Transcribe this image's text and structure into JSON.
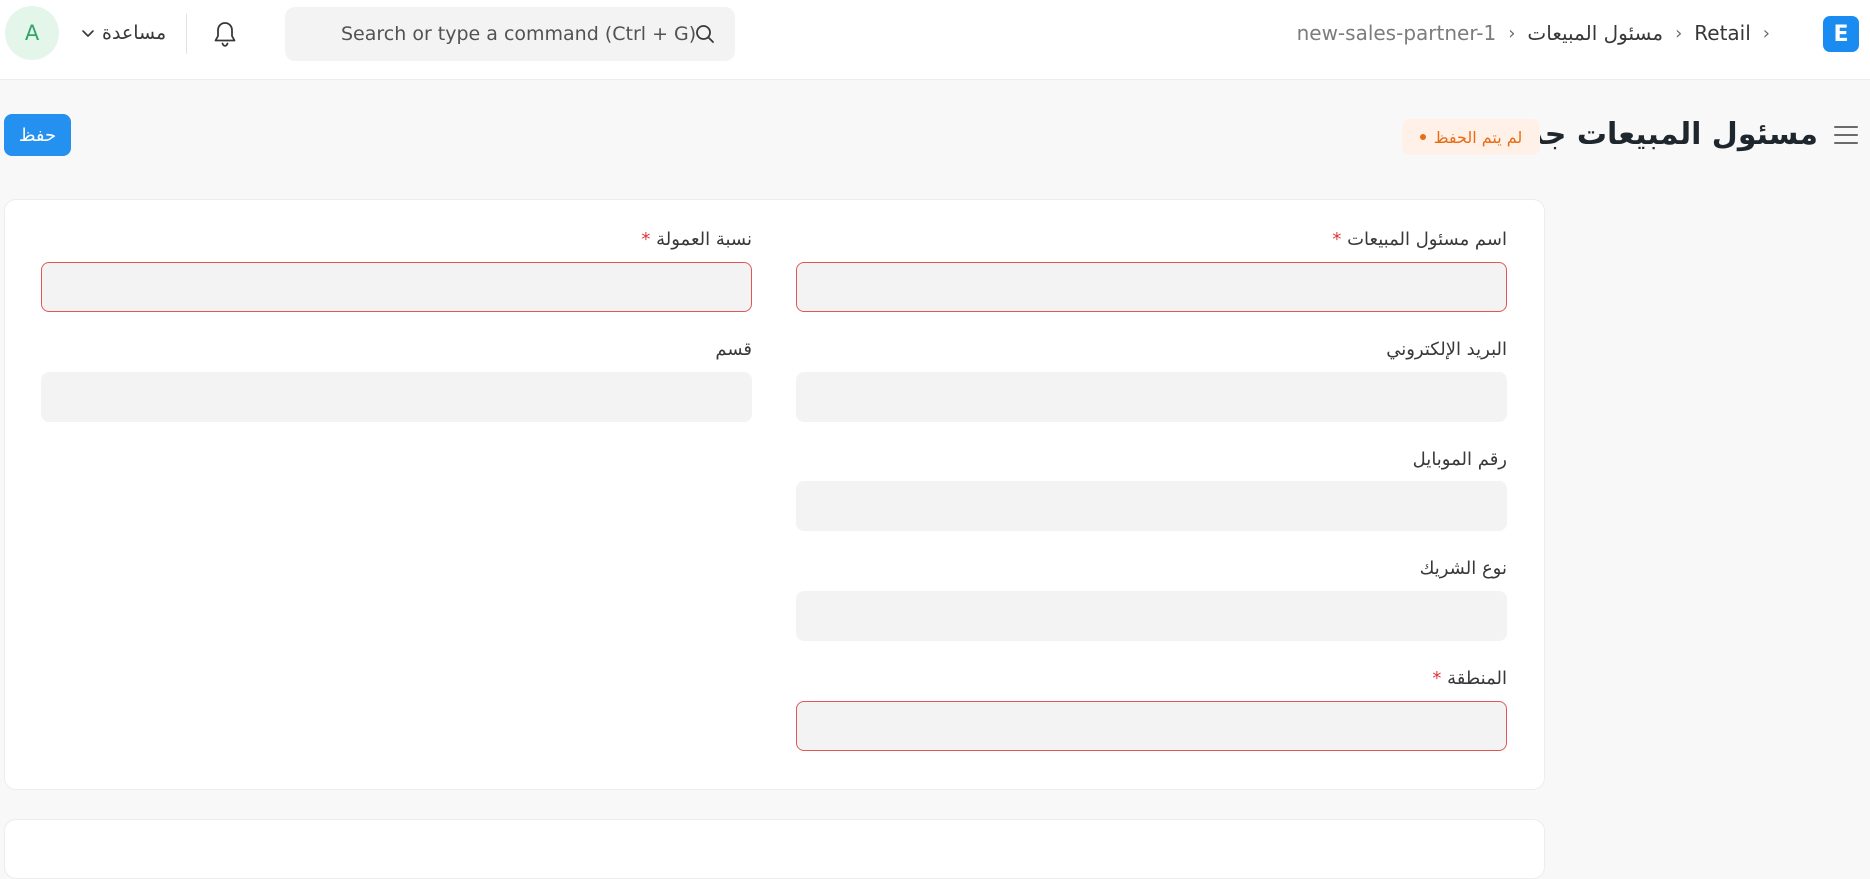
{
  "navbar": {
    "avatar_initial": "A",
    "help_label": "مساعدة",
    "search_placeholder": "Search or type a command (Ctrl + G)",
    "app_logo": "E",
    "breadcrumb": [
      "Retail",
      "مسئول المبيعات",
      "new-sales-partner-1"
    ]
  },
  "page": {
    "title": "مسئول المبيعات جديد",
    "status": "لم يتم الحفظ",
    "save_label": "حفظ"
  },
  "form": {
    "sales_partner_name": {
      "label": "اسم مسئول المبيعات",
      "required": "*",
      "value": ""
    },
    "commission_rate": {
      "label": "نسبة العمولة",
      "required": "*",
      "value": ""
    },
    "email": {
      "label": "البريد الإلكتروني",
      "value": ""
    },
    "department": {
      "label": "قسم",
      "value": ""
    },
    "mobile": {
      "label": "رقم الموبايل",
      "value": ""
    },
    "partner_type": {
      "label": "نوع الشريك",
      "value": ""
    },
    "territory": {
      "label": "المنطقة",
      "required": "*",
      "value": ""
    }
  },
  "colors": {
    "primary": "#2490ef",
    "indicator_orange": "#e86c13",
    "invalid_border": "#e15757",
    "avatar_green": "#30a66d"
  },
  "icons": [
    "search-icon",
    "bell-icon",
    "chevron-down-icon",
    "hamburger-icon",
    "app-logo-icon"
  ]
}
